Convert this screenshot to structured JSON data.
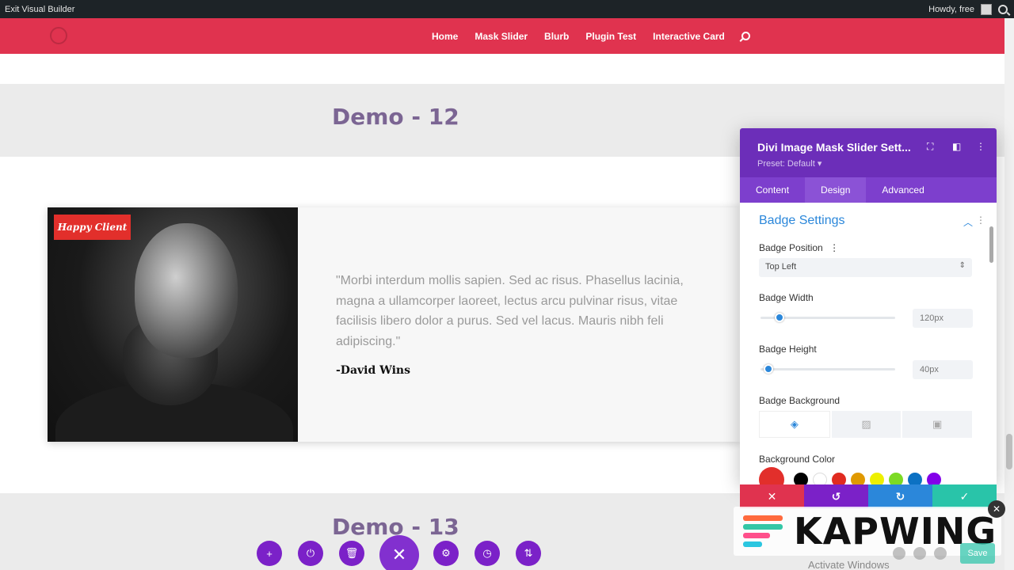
{
  "admin_bar": {
    "exit_label": "Exit Visual Builder",
    "greeting": "Howdy, free"
  },
  "nav": {
    "items": [
      "Home",
      "Mask Slider",
      "Blurb",
      "Plugin Test",
      "Interactive Card"
    ]
  },
  "sections": {
    "demo12_title": "Demo - 12",
    "demo13_title": "Demo - 13"
  },
  "card": {
    "badge": "Happy Client",
    "quote": "\"Morbi interdum mollis sapien. Sed ac risus. Phasellus lacinia, magna a ullamcorper laoreet, lectus arcu pulvinar risus, vitae facilisis libero dolor a purus. Sed vel lacus. Mauris nibh feli adipiscing.\"",
    "author": "-David Wins"
  },
  "panel": {
    "title": "Divi Image Mask Slider Sett...",
    "preset": "Preset: Default ▾",
    "tabs": [
      "Content",
      "Design",
      "Advanced"
    ],
    "active_tab": "Design",
    "section_title": "Badge Settings",
    "badge_position_label": "Badge Position",
    "badge_position_value": "Top Left",
    "badge_width_label": "Badge Width",
    "badge_width_value": "120px",
    "badge_width_slider": 0.14,
    "badge_height_label": "Badge Height",
    "badge_height_value": "40px",
    "badge_height_slider": 0.06,
    "badge_background_label": "Badge Background",
    "background_color_label": "Background Color",
    "colors": {
      "active": "#e22f2b",
      "swatches": [
        "#000000",
        "#ffffff",
        "#e02b20",
        "#e09900",
        "#edf000",
        "#7cda24",
        "#0c71c3",
        "#8300e9"
      ]
    }
  },
  "actions": {
    "colors": [
      "#e0334f",
      "#7b21c8",
      "#2b87da",
      "#29c4a9"
    ]
  },
  "watermark": {
    "brand": "KAPWING",
    "activate": "Activate Windows",
    "save": "Save"
  }
}
